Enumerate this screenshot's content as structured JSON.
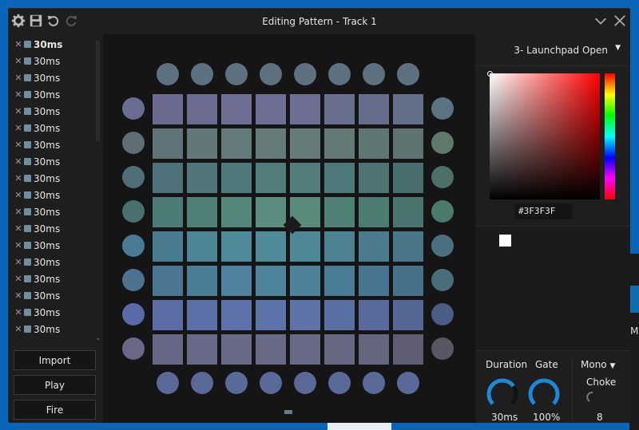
{
  "window": {
    "title": "Editing Pattern - Track 1"
  },
  "toolbar_icons": [
    "gear-icon",
    "save-icon",
    "undo-icon",
    "redo-icon"
  ],
  "window_controls": [
    "chevron-down-icon",
    "close-icon"
  ],
  "frames": [
    {
      "label": "30ms",
      "selected": true
    },
    {
      "label": "30ms"
    },
    {
      "label": "30ms"
    },
    {
      "label": "30ms"
    },
    {
      "label": "30ms"
    },
    {
      "label": "30ms"
    },
    {
      "label": "30ms"
    },
    {
      "label": "30ms"
    },
    {
      "label": "30ms"
    },
    {
      "label": "30ms"
    },
    {
      "label": "30ms"
    },
    {
      "label": "30ms"
    },
    {
      "label": "30ms"
    },
    {
      "label": "30ms"
    },
    {
      "label": "30ms"
    },
    {
      "label": "30ms"
    },
    {
      "label": "30ms"
    },
    {
      "label": "30ms"
    }
  ],
  "buttons": {
    "import": "Import",
    "play": "Play",
    "fire": "Fire"
  },
  "grid": {
    "top": [
      "#5e7180",
      "#5e7180",
      "#5e7180",
      "#5e7180",
      "#5e7180",
      "#5e7180",
      "#5e7180",
      "#5e7180"
    ],
    "left": [
      "#6a6d8f",
      "#5d6e75",
      "#4e6f7a",
      "#49706e",
      "#4b7a95",
      "#4c7290",
      "#5a6aa8",
      "#6a6787"
    ],
    "right": [
      "#5e7382",
      "#5e7a6a",
      "#4c7068",
      "#4a7a6c",
      "#4b6f7e",
      "#4a6d7a",
      "#4a5d86",
      "#595763"
    ],
    "bottom": [
      "#5a6a98",
      "#5a6a98",
      "#5a6a98",
      "#5a6a98",
      "#5a6a98",
      "#5a6a98",
      "#5a6a98",
      "#5a6a98"
    ],
    "pads": [
      [
        "#6a6b8f",
        "#6c6c90",
        "#6f6f95",
        "#6e6f94",
        "#6c7094",
        "#6b6f8e",
        "#666d8a",
        "#637089"
      ],
      [
        "#5f7478",
        "#627778",
        "#657a7a",
        "#657b7a",
        "#667c79",
        "#647a77",
        "#607673",
        "#5e7372"
      ],
      [
        "#4f727a",
        "#4f777a",
        "#50797c",
        "#537c7c",
        "#537c7d",
        "#4f787a",
        "#4d7375",
        "#4a6e70"
      ],
      [
        "#4c7a75",
        "#4f8078",
        "#55887c",
        "#5a8d80",
        "#5a8c7d",
        "#4f8176",
        "#4c7b72",
        "#4a7470"
      ],
      [
        "#4a7c91",
        "#4c8596",
        "#4e8a9a",
        "#4f8b98",
        "#4f8896",
        "#4c8292",
        "#4a7c8d",
        "#497688"
      ],
      [
        "#4b7592",
        "#4b7c98",
        "#4e829e",
        "#4e849e",
        "#4e829a",
        "#4b7c95",
        "#487690",
        "#47718b"
      ],
      [
        "#5c6ca6",
        "#5c70a8",
        "#5d72ab",
        "#5d74ab",
        "#5e74a8",
        "#5a70a2",
        "#586b9c",
        "#566694"
      ],
      [
        "#676887",
        "#696a89",
        "#686a86",
        "#686a86",
        "#686984",
        "#676782",
        "#65657f",
        "#5f5d74"
      ]
    ]
  },
  "device": {
    "label": "3- Launchpad Open"
  },
  "color_hex": "#3F3F3F",
  "colors": {
    "accent": "#1e88d8",
    "swatch": "#ffffff"
  },
  "params": {
    "duration_label": "Duration",
    "duration_value": "30ms",
    "duration_level": 0.7,
    "gate_label": "Gate",
    "gate_value": "100%",
    "gate_level": 1.0,
    "mode_label": "Mono",
    "choke_label": "Choke",
    "choke_value": "8"
  }
}
